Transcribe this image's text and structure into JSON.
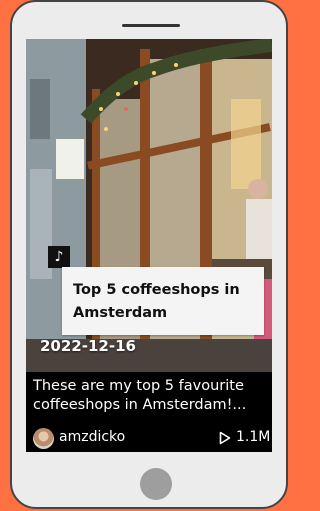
{
  "post": {
    "title": "Top 5 coffeeshops in Amsterdam",
    "date": "2022-12-16",
    "caption_line1": "These are my top 5 favourite",
    "caption_line2": "coffeeshops in Amsterdam!...",
    "username": "amzdicko",
    "views": "1.1M"
  },
  "icons": {
    "brand": "tiktok-icon",
    "views": "play-icon",
    "home": "home-button"
  },
  "colors": {
    "background": "#ff7043",
    "phone": "#ececec",
    "screen": "#000000",
    "title_card": "#f4f4f4"
  }
}
